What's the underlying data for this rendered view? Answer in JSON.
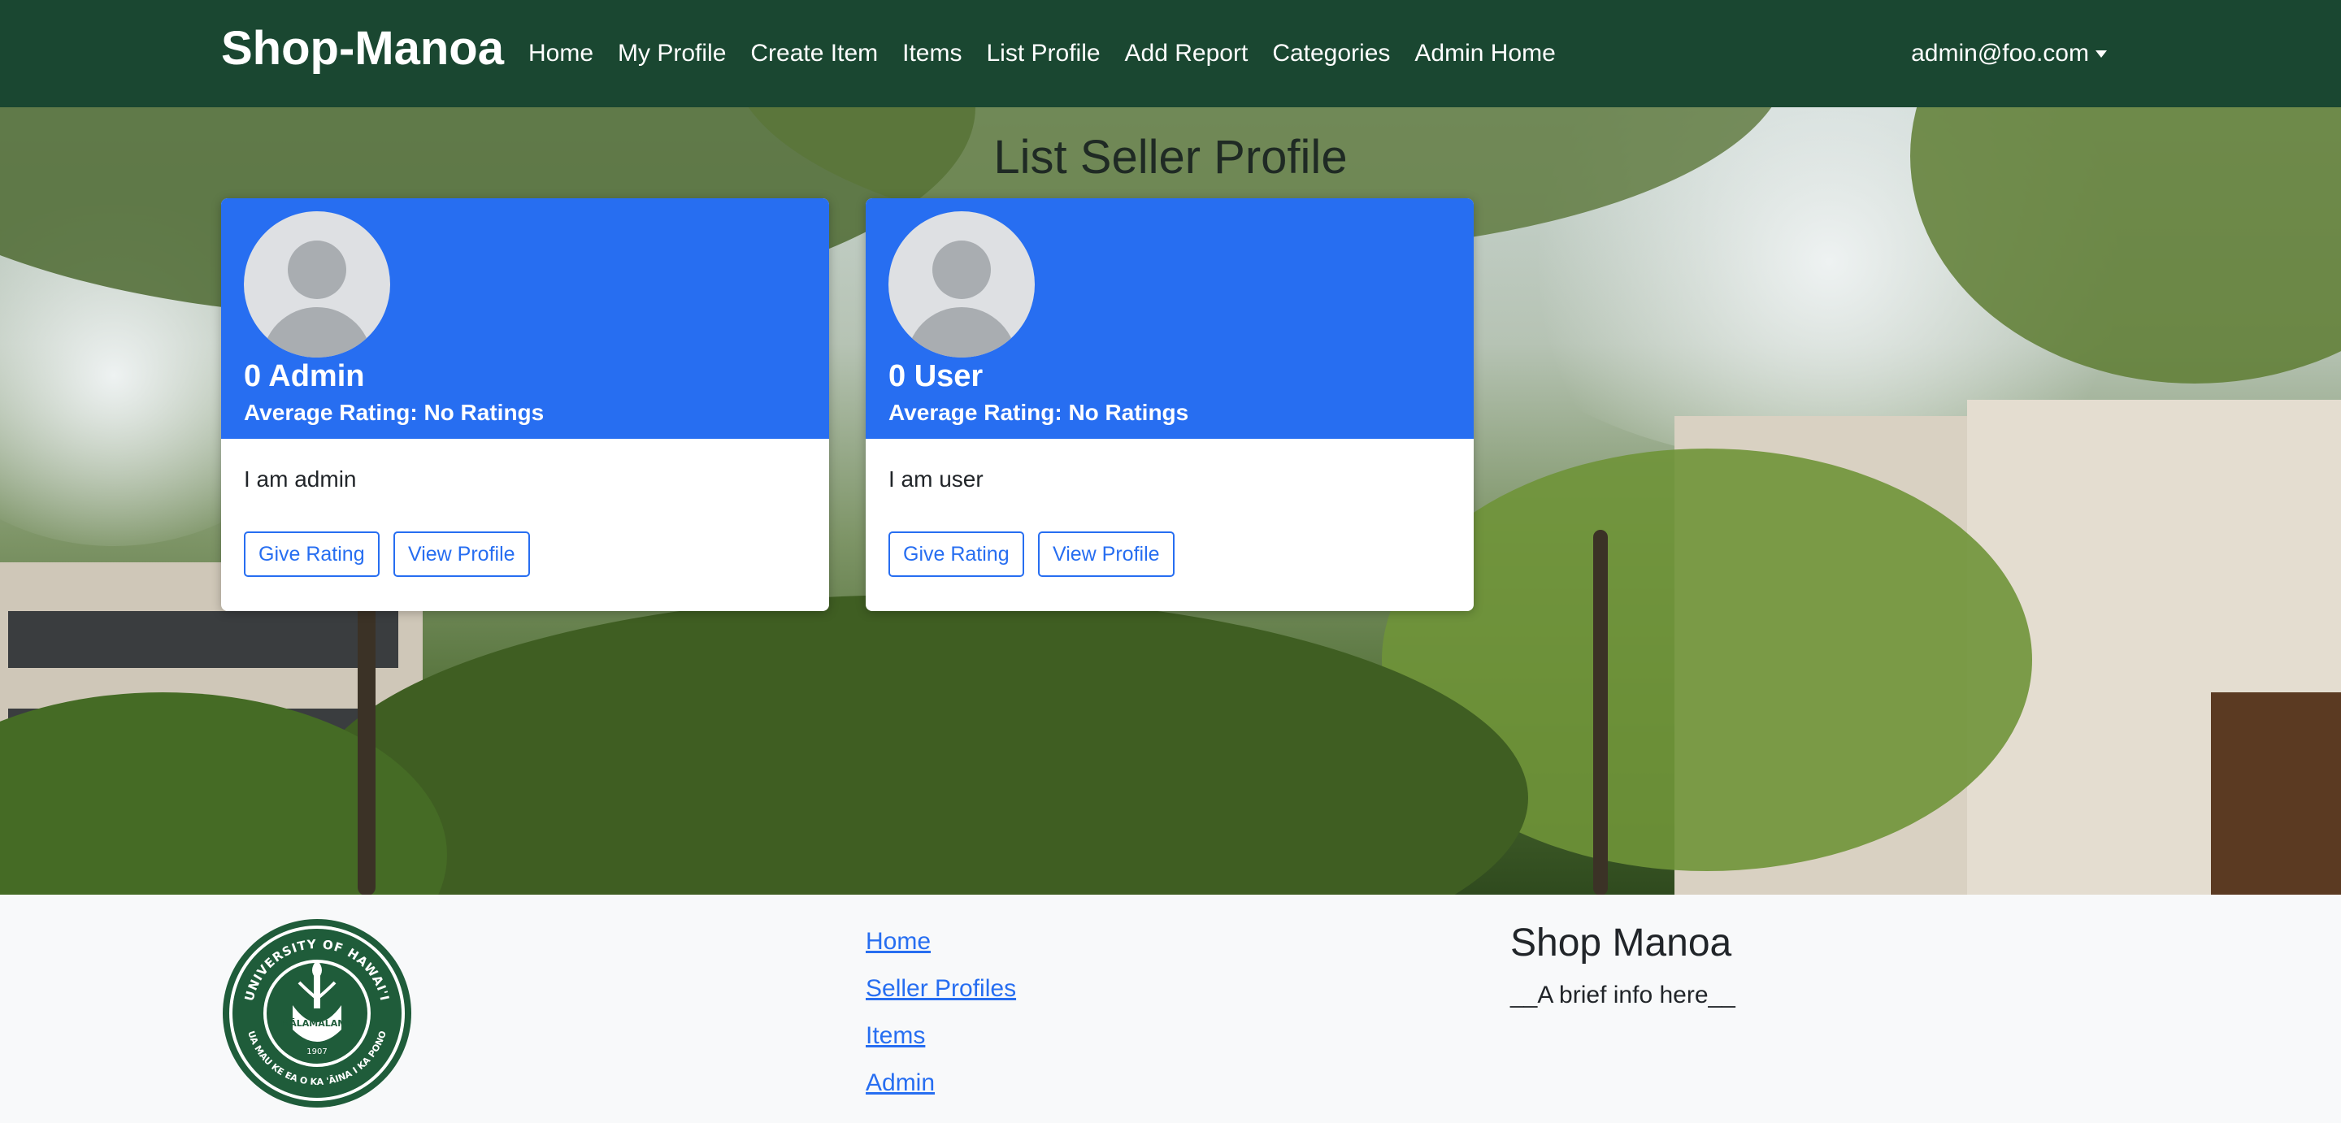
{
  "navbar": {
    "brand": "Shop-Manoa",
    "links": [
      "Home",
      "My Profile",
      "Create Item",
      "Items",
      "List Profile",
      "Add Report",
      "Categories",
      "Admin Home"
    ],
    "user": "admin@foo.com",
    "background_color": "#1a4731"
  },
  "main": {
    "title": "List Seller Profile",
    "cards": [
      {
        "name": "0 Admin",
        "rating": "Average Rating: No Ratings",
        "description": "I am admin",
        "give_rating": "Give Rating",
        "view_profile": "View Profile"
      },
      {
        "name": "0 User",
        "rating": "Average Rating: No Ratings",
        "description": "I am user",
        "give_rating": "Give Rating",
        "view_profile": "View Profile"
      }
    ],
    "card_header_color": "#276ef1"
  },
  "footer": {
    "seal": {
      "top_text": "UNIVERSITY OF HAWAI'I",
      "bottom_text": "UA MAU KE EA O KA 'ĀINA I KA PONO",
      "center_text": "MĀLAMALAMA",
      "year": "1907"
    },
    "links": [
      "Home",
      "Seller Profiles",
      "Items",
      "Admin"
    ],
    "title": "Shop Manoa",
    "info": "__A brief info here__"
  },
  "icons": [
    "caret-down-icon",
    "avatar-placeholder-icon",
    "university-seal-logo"
  ]
}
